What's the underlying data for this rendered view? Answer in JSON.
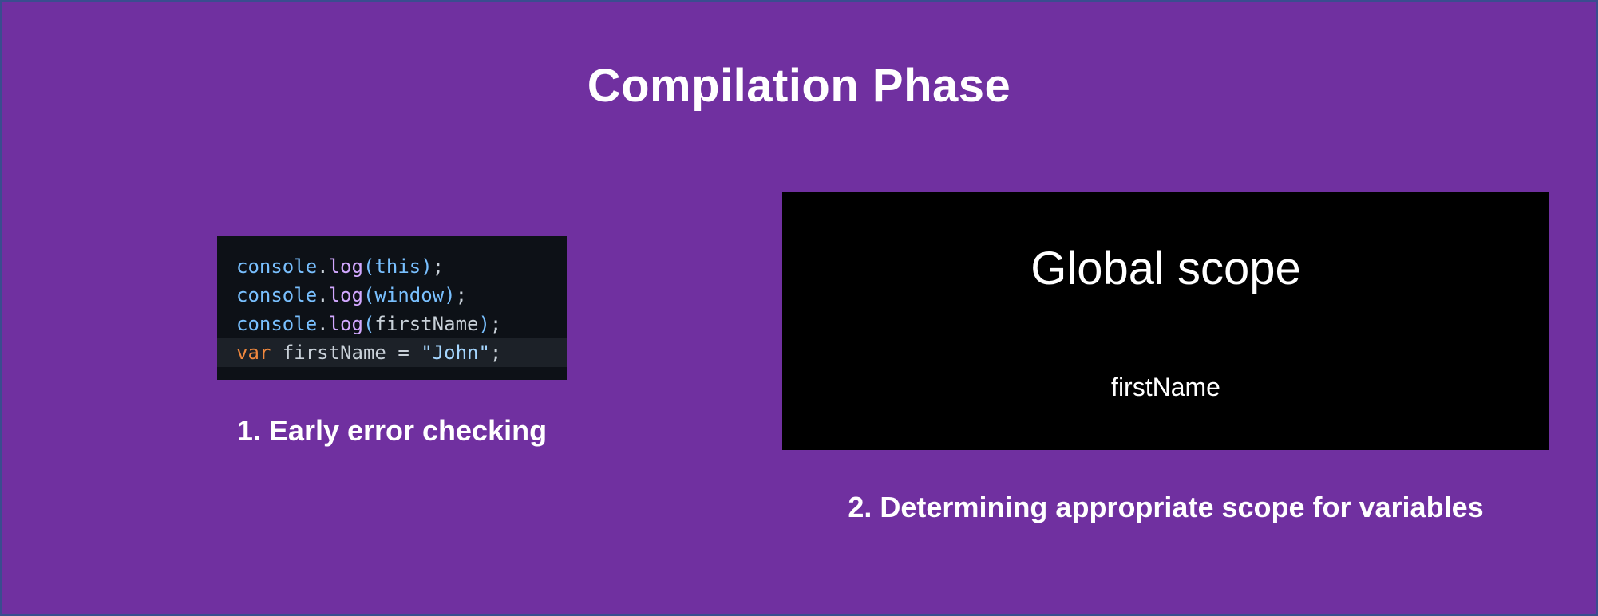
{
  "title": "Compilation Phase",
  "code_snippet": {
    "lines": [
      {
        "obj": "console",
        "dot": ".",
        "method": "log",
        "open": "(",
        "arg": "this",
        "close": ")",
        "end": ";"
      },
      {
        "obj": "console",
        "dot": ".",
        "method": "log",
        "open": "(",
        "arg": "window",
        "close": ")",
        "end": ";"
      },
      {
        "obj": "console",
        "dot": ".",
        "method": "log",
        "open": "(",
        "arg": "firstName",
        "close": ")",
        "end": ";"
      }
    ],
    "declaration": {
      "keyword": "var",
      "name": "firstName",
      "op": "=",
      "value": "\"John\"",
      "end": ";"
    }
  },
  "caption_1": "1. Early error checking",
  "scope_box": {
    "title": "Global scope",
    "variable": "firstName"
  },
  "caption_2": "2. Determining appropriate scope for variables",
  "colors": {
    "background": "#7030a0",
    "code_background": "#0d1117",
    "scope_background": "#000000",
    "text": "#ffffff"
  }
}
